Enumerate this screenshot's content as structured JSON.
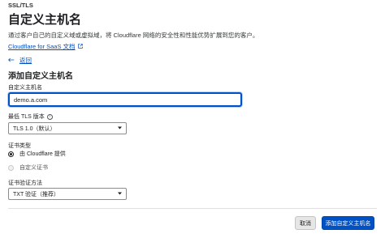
{
  "header": {
    "breadcrumb": "SSL/TLS",
    "title": "自定义主机名",
    "description": "通过客户自己的自定义域或虚拟域，将 Cloudflare 网络的安全性和性能优势扩展到您的客户。",
    "doc_link": "Cloudflare for SaaS 文档"
  },
  "nav": {
    "back_label": "返回"
  },
  "form": {
    "section_title": "添加自定义主机名",
    "hostname_label": "自定义主机名",
    "hostname_value": "demo.a.com",
    "tls_label": "最低 TLS 版本",
    "tls_value": "TLS 1.0（默认）",
    "cert_type_label": "证书类型",
    "cert_options": [
      {
        "label": "由 Cloudflare 提供",
        "checked": true
      },
      {
        "label": "自定义证书",
        "checked": false
      }
    ],
    "validation_label": "证书验证方法",
    "validation_value": "TXT 验证（推荐）"
  },
  "footer": {
    "cancel_label": "取消",
    "submit_label": "添加自定义主机名"
  },
  "colors": {
    "accent": "#0051c3"
  },
  "icons": {
    "external": "external-link-icon",
    "back": "arrow-left-icon",
    "info": "info-icon",
    "chevron": "chevron-down-icon"
  }
}
